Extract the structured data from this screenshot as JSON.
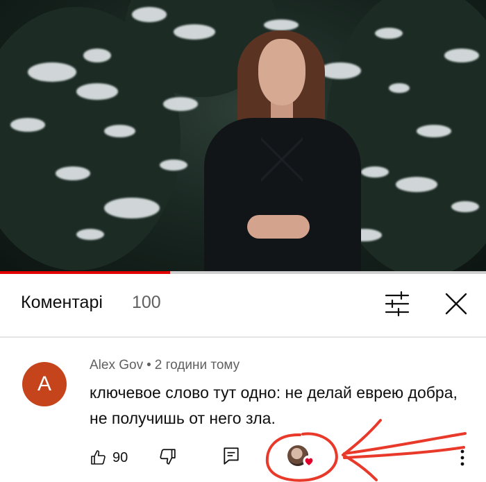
{
  "video": {
    "progress_fraction": 0.35
  },
  "comments_header": {
    "title": "Коментарі",
    "count": "100",
    "filter_icon": "sort-filter-icon",
    "close_icon": "close-icon"
  },
  "comment": {
    "avatar_letter": "A",
    "avatar_color": "#c5441c",
    "author": "Alex Gov",
    "separator": "•",
    "time": "2 години тому",
    "text": "ключевое слово тут одно: не делай еврею добра, не получишь от него зла.",
    "like_count": "90",
    "creator_heart": true
  },
  "colors": {
    "progress": "#e00000",
    "annotation": "#e8392a",
    "heart": "#e0002a"
  },
  "icons": [
    "thumb-up-icon",
    "thumb-down-icon",
    "reply-icon",
    "heart-icon",
    "more-vert-icon"
  ]
}
